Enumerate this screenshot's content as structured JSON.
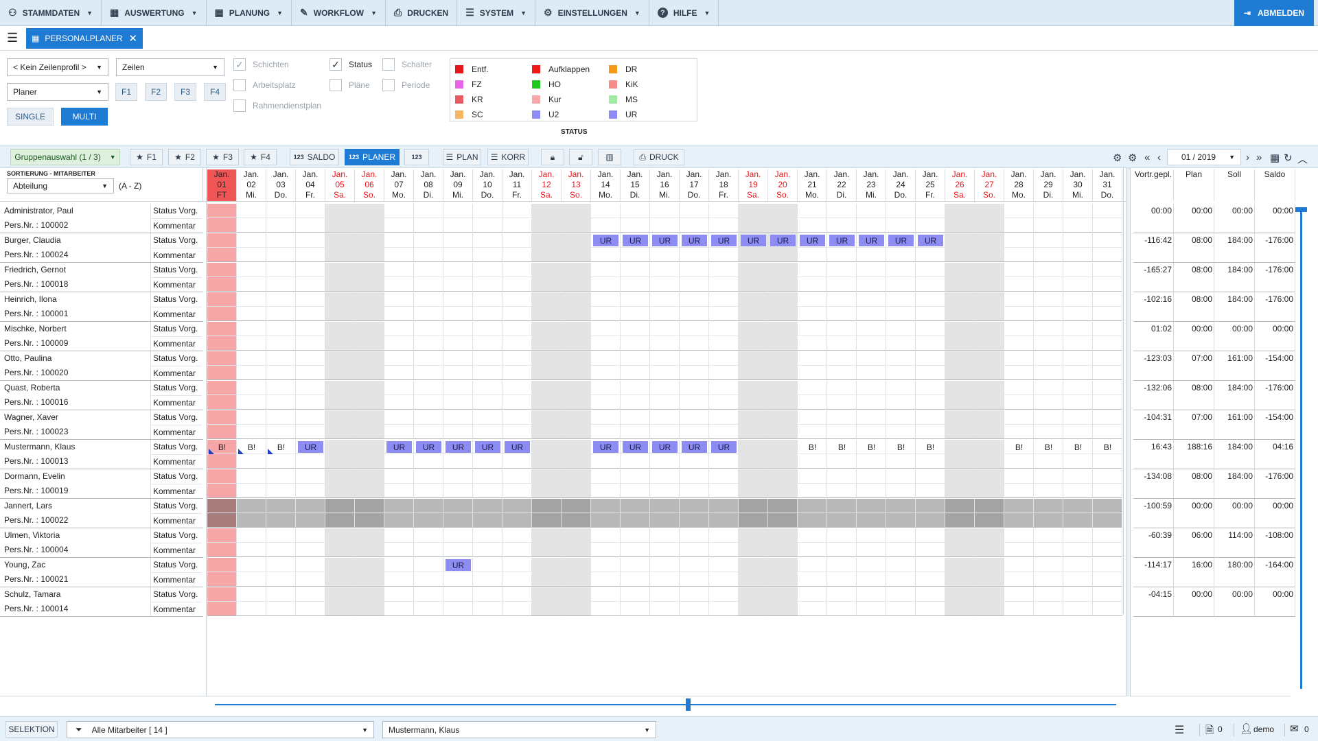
{
  "menu": [
    {
      "label": "STAMMDATEN",
      "icon": "people-icon",
      "caret": true
    },
    {
      "label": "AUSWERTUNG",
      "icon": "calendar-icon",
      "caret": true
    },
    {
      "label": "PLANUNG",
      "icon": "calendar-icon",
      "caret": true
    },
    {
      "label": "WORKFLOW",
      "icon": "pencil-icon",
      "caret": true
    },
    {
      "label": "DRUCKEN",
      "icon": "printer-icon",
      "caret": false
    },
    {
      "label": "SYSTEM",
      "icon": "server-icon",
      "caret": true
    },
    {
      "label": "EINSTELLUNGEN",
      "icon": "gear-icon",
      "caret": true
    },
    {
      "label": "HILFE",
      "icon": "help-icon",
      "caret": true
    }
  ],
  "logout_label": "ABMELDEN",
  "tab": {
    "label": "PERSONALPLANER"
  },
  "filters": {
    "zeilenprofil": "< Kein Zeilenprofil >",
    "zeilen": "Zeilen",
    "planer": "Planer",
    "fkeys": [
      "F1",
      "F2",
      "F3",
      "F4"
    ],
    "single": "SINGLE",
    "multi": "MULTI",
    "checks": [
      {
        "label": "Schichten",
        "checked": true,
        "disabled": true
      },
      {
        "label": "Arbeitsplatz",
        "checked": false,
        "disabled": true
      },
      {
        "label": "Rahmendienstplan",
        "checked": false,
        "disabled": true
      },
      {
        "label": "Status",
        "checked": true,
        "disabled": false
      },
      {
        "label": "Pläne",
        "checked": false,
        "disabled": true
      },
      {
        "label": "Schalter",
        "checked": false,
        "disabled": true
      },
      {
        "label": "Periode",
        "checked": false,
        "disabled": true
      }
    ]
  },
  "legend": {
    "title": "STATUS",
    "items": [
      {
        "label": "Entf.",
        "color": "#e8141c"
      },
      {
        "label": "FZ",
        "color": "#e765e8"
      },
      {
        "label": "KR",
        "color": "#ea5a63"
      },
      {
        "label": "SC",
        "color": "#f4b565"
      },
      {
        "label": "Aufklappen",
        "color": "#f01818"
      },
      {
        "label": "HO",
        "color": "#1ec61e"
      },
      {
        "label": "Kur",
        "color": "#f7a7a7"
      },
      {
        "label": "U2",
        "color": "#8c8cf2"
      },
      {
        "label": "DR",
        "color": "#f39a1d"
      },
      {
        "label": "KiK",
        "color": "#f58d8d"
      },
      {
        "label": "MS",
        "color": "#a2eaa2"
      },
      {
        "label": "UR",
        "color": "#8c8cf2"
      }
    ]
  },
  "toolbar": {
    "gruppenauswahl": "Gruppenauswahl (1 / 3)",
    "fav": [
      "F1",
      "F2",
      "F3",
      "F4"
    ],
    "saldo": "SALDO",
    "planer": "PLANER",
    "num": "123",
    "plan": "PLAN",
    "korr": "KORR",
    "druck": "DRUCK",
    "period": "01 / 2019"
  },
  "sort": {
    "title": "SORTIERUNG - MITARBEITER",
    "field": "Abteilung",
    "order": "(A - Z)"
  },
  "days": [
    {
      "m": "Jan.",
      "d": "01",
      "w": "FT",
      "red": true
    },
    {
      "m": "Jan.",
      "d": "02",
      "w": "Mi.",
      "red": false
    },
    {
      "m": "Jan.",
      "d": "03",
      "w": "Do.",
      "red": false
    },
    {
      "m": "Jan.",
      "d": "04",
      "w": "Fr.",
      "red": false
    },
    {
      "m": "Jan.",
      "d": "05",
      "w": "Sa.",
      "red": true
    },
    {
      "m": "Jan.",
      "d": "06",
      "w": "So.",
      "red": true
    },
    {
      "m": "Jan.",
      "d": "07",
      "w": "Mo.",
      "red": false
    },
    {
      "m": "Jan.",
      "d": "08",
      "w": "Di.",
      "red": false
    },
    {
      "m": "Jan.",
      "d": "09",
      "w": "Mi.",
      "red": false
    },
    {
      "m": "Jan.",
      "d": "10",
      "w": "Do.",
      "red": false
    },
    {
      "m": "Jan.",
      "d": "11",
      "w": "Fr.",
      "red": false
    },
    {
      "m": "Jan.",
      "d": "12",
      "w": "Sa.",
      "red": true
    },
    {
      "m": "Jan.",
      "d": "13",
      "w": "So.",
      "red": true
    },
    {
      "m": "Jan.",
      "d": "14",
      "w": "Mo.",
      "red": false
    },
    {
      "m": "Jan.",
      "d": "15",
      "w": "Di.",
      "red": false
    },
    {
      "m": "Jan.",
      "d": "16",
      "w": "Mi.",
      "red": false
    },
    {
      "m": "Jan.",
      "d": "17",
      "w": "Do.",
      "red": false
    },
    {
      "m": "Jan.",
      "d": "18",
      "w": "Fr.",
      "red": false
    },
    {
      "m": "Jan.",
      "d": "19",
      "w": "Sa.",
      "red": true
    },
    {
      "m": "Jan.",
      "d": "20",
      "w": "So.",
      "red": true
    },
    {
      "m": "Jan.",
      "d": "21",
      "w": "Mo.",
      "red": false
    },
    {
      "m": "Jan.",
      "d": "22",
      "w": "Di.",
      "red": false
    },
    {
      "m": "Jan.",
      "d": "23",
      "w": "Mi.",
      "red": false
    },
    {
      "m": "Jan.",
      "d": "24",
      "w": "Do.",
      "red": false
    },
    {
      "m": "Jan.",
      "d": "25",
      "w": "Fr.",
      "red": false
    },
    {
      "m": "Jan.",
      "d": "26",
      "w": "Sa.",
      "red": true
    },
    {
      "m": "Jan.",
      "d": "27",
      "w": "So.",
      "red": true
    },
    {
      "m": "Jan.",
      "d": "28",
      "w": "Mo.",
      "red": false
    },
    {
      "m": "Jan.",
      "d": "29",
      "w": "Di.",
      "red": false
    },
    {
      "m": "Jan.",
      "d": "30",
      "w": "Mi.",
      "red": false
    },
    {
      "m": "Jan.",
      "d": "31",
      "w": "Do.",
      "red": false
    }
  ],
  "sum_headers": [
    "Vortr.gepl.",
    "Plan",
    "Soll",
    "Saldo"
  ],
  "row_labels": {
    "status": "Status Vorg.",
    "comment": "Kommentar",
    "persnr_prefix": "Pers.Nr. : "
  },
  "employees": [
    {
      "name": "Administrator, Paul",
      "persnr": "100002",
      "vortr": "00:00",
      "plan": "00:00",
      "soll": "00:00",
      "saldo": "00:00",
      "ur": [],
      "b": []
    },
    {
      "name": "Burger, Claudia",
      "persnr": "100024",
      "vortr": "-116:42",
      "plan": "08:00",
      "soll": "184:00",
      "saldo": "-176:00",
      "ur": [
        14,
        15,
        16,
        17,
        18,
        19,
        20,
        21,
        22,
        23,
        24,
        25
      ],
      "b": []
    },
    {
      "name": "Friedrich, Gernot",
      "persnr": "100018",
      "vortr": "-165:27",
      "plan": "08:00",
      "soll": "184:00",
      "saldo": "-176:00",
      "ur": [],
      "b": []
    },
    {
      "name": "Heinrich, Ilona",
      "persnr": "100001",
      "vortr": "-102:16",
      "plan": "08:00",
      "soll": "184:00",
      "saldo": "-176:00",
      "ur": [],
      "b": []
    },
    {
      "name": "Mischke, Norbert",
      "persnr": "100009",
      "vortr": "01:02",
      "plan": "00:00",
      "soll": "00:00",
      "saldo": "00:00",
      "ur": [],
      "b": []
    },
    {
      "name": "Otto, Paulina",
      "persnr": "100020",
      "vortr": "-123:03",
      "plan": "07:00",
      "soll": "161:00",
      "saldo": "-154:00",
      "ur": [],
      "b": []
    },
    {
      "name": "Quast, Roberta",
      "persnr": "100016",
      "vortr": "-132:06",
      "plan": "08:00",
      "soll": "184:00",
      "saldo": "-176:00",
      "ur": [],
      "b": []
    },
    {
      "name": "Wagner, Xaver",
      "persnr": "100023",
      "vortr": "-104:31",
      "plan": "07:00",
      "soll": "161:00",
      "saldo": "-154:00",
      "ur": [],
      "b": []
    },
    {
      "name": "Mustermann, Klaus",
      "persnr": "100013",
      "vortr": "16:43",
      "plan": "188:16",
      "soll": "184:00",
      "saldo": "04:16",
      "ur": [
        4,
        7,
        8,
        9,
        10,
        11,
        14,
        15,
        16,
        17,
        18
      ],
      "b": [
        1,
        2,
        3,
        21,
        22,
        23,
        24,
        25,
        28,
        29,
        30,
        31
      ]
    },
    {
      "name": "Dormann, Evelin",
      "persnr": "100019",
      "vortr": "-134:08",
      "plan": "08:00",
      "soll": "184:00",
      "saldo": "-176:00",
      "ur": [],
      "b": []
    },
    {
      "name": "Jannert, Lars",
      "persnr": "100022",
      "vortr": "-100:59",
      "plan": "00:00",
      "soll": "00:00",
      "saldo": "00:00",
      "ur": [],
      "b": [],
      "inactive": true
    },
    {
      "name": "Ulmen, Viktoria",
      "persnr": "100004",
      "vortr": "-60:39",
      "plan": "06:00",
      "soll": "114:00",
      "saldo": "-108:00",
      "ur": [],
      "b": []
    },
    {
      "name": "Young, Zac",
      "persnr": "100021",
      "vortr": "-114:17",
      "plan": "16:00",
      "soll": "180:00",
      "saldo": "-164:00",
      "ur": [
        9
      ],
      "b": []
    },
    {
      "name": "Schulz, Tamara",
      "persnr": "100014",
      "vortr": "-04:15",
      "plan": "00:00",
      "soll": "00:00",
      "saldo": "00:00",
      "ur": [],
      "b": []
    }
  ],
  "badge_labels": {
    "ur": "UR",
    "b": "B!"
  },
  "bottom": {
    "selektion": "SELEKTION",
    "filter": "Alle Mitarbeiter  [ 14 ]",
    "person": "Mustermann, Klaus",
    "pdf_count": "0",
    "user": "demo",
    "mail_count": "0"
  }
}
